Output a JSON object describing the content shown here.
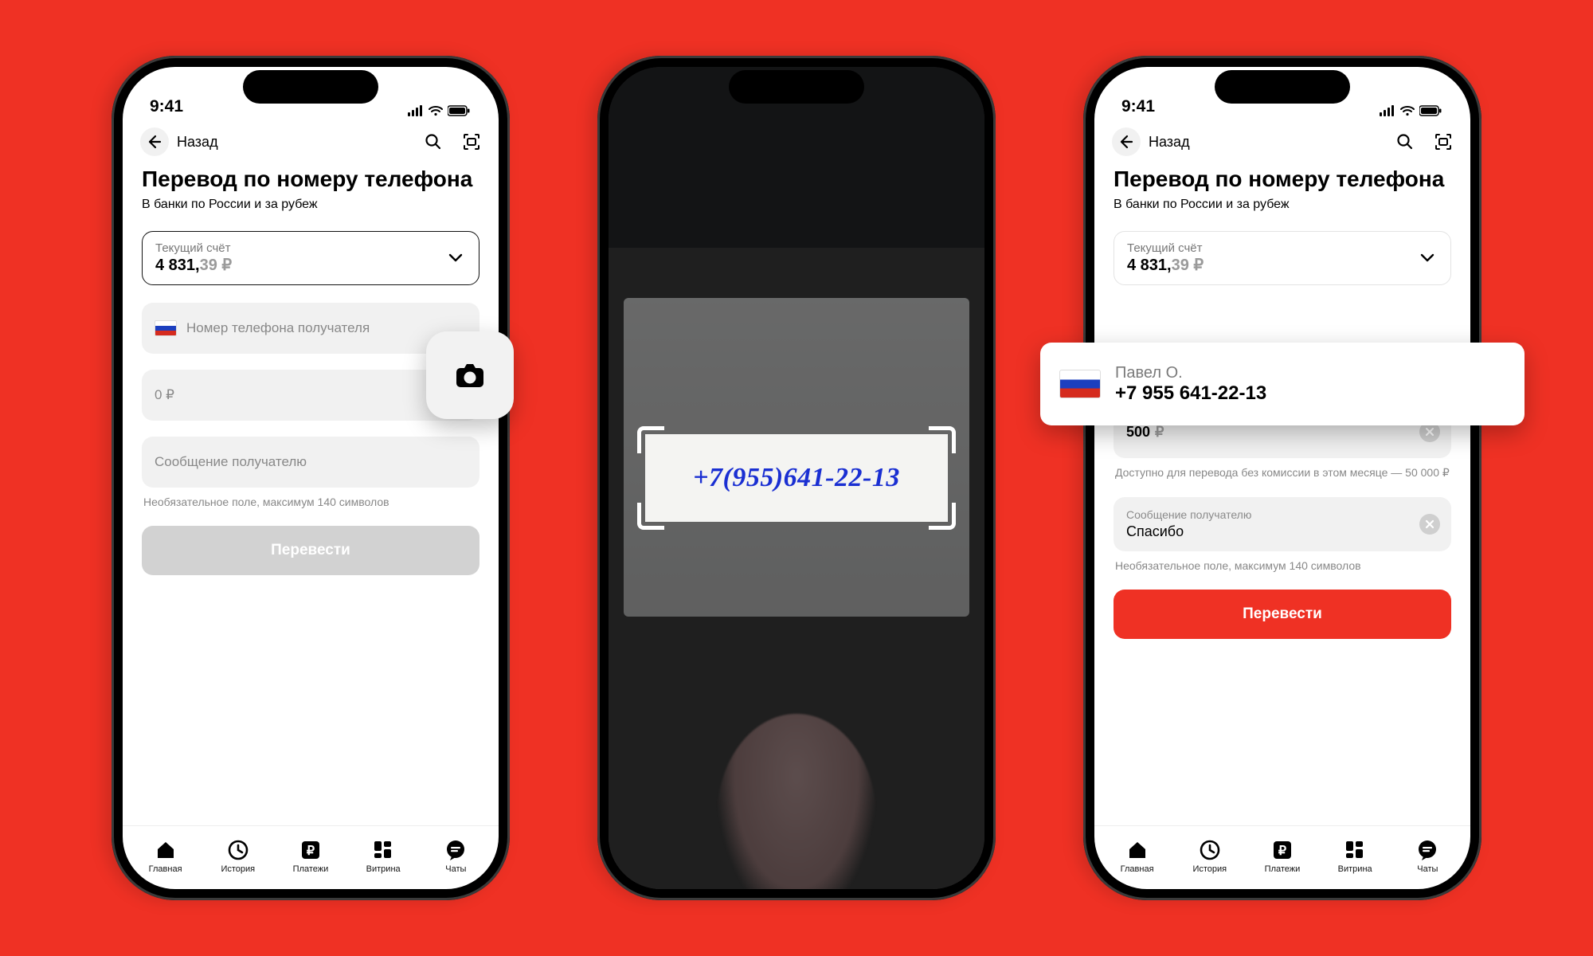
{
  "status": {
    "time": "9:41"
  },
  "header": {
    "back": "Назад"
  },
  "page": {
    "title": "Перевод по номеру телефона",
    "subtitle": "В банки по России и за рубеж"
  },
  "account": {
    "label": "Текущий счёт",
    "balance_main": "4 831,",
    "balance_sub": "39 ₽"
  },
  "phone_input": {
    "placeholder": "Номер телефона получателя"
  },
  "amount": {
    "empty_placeholder": "0 ₽",
    "filled_value": "500",
    "currency": "₽",
    "fee_note": "Доступно для перевода без комиссии в этом месяце — 50 000 ₽"
  },
  "message": {
    "label": "Сообщение получателю",
    "value_filled": "Спасибо",
    "helper": "Необязательное поле, максимум 140 символов"
  },
  "cta": {
    "label": "Перевести"
  },
  "scan": {
    "detected_number": "+7(955)641-22-13"
  },
  "contact": {
    "name": "Павел О.",
    "phone": "+7 955 641-22-13"
  },
  "tabs": {
    "home": "Главная",
    "history": "История",
    "payments": "Платежи",
    "showcase": "Витрина",
    "chats": "Чаты"
  }
}
